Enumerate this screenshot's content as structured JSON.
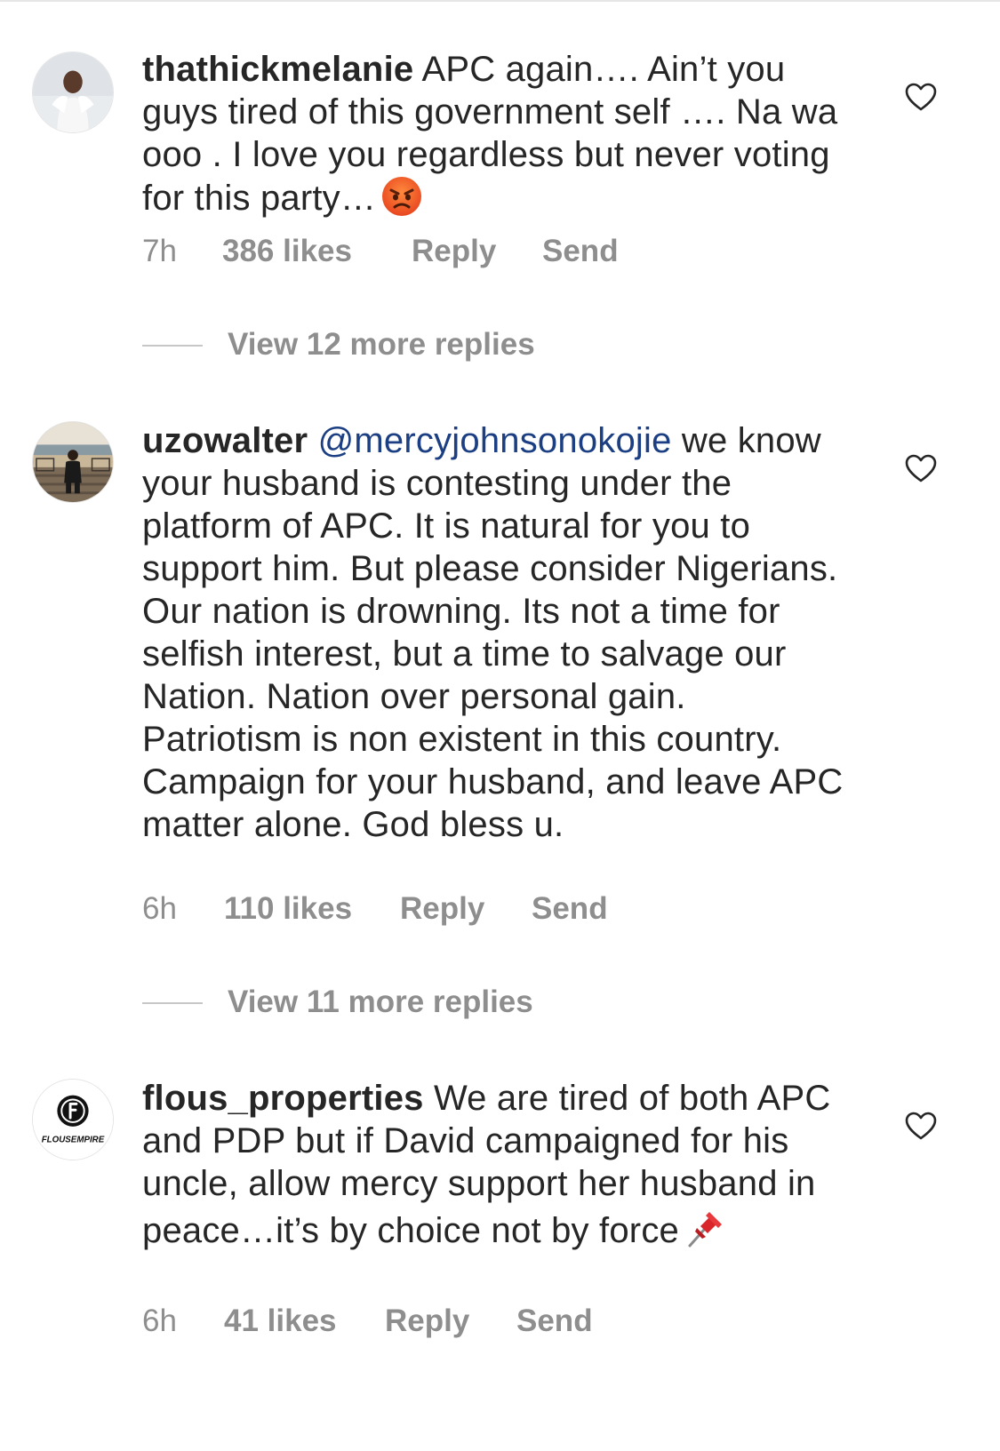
{
  "comments": [
    {
      "username": "thathickmelanie",
      "text": "APC again…. Ain’t you guys tired of this government self …. Na wa ooo . I love you regardless but never voting for this party…",
      "emoji": "angry-face-emoji",
      "time": "7h",
      "likes": "386 likes",
      "reply_label": "Reply",
      "send_label": "Send",
      "view_replies": "View 12 more replies"
    },
    {
      "username": "uzowalter",
      "mention": "@mercyjohnsonokojie",
      "text": "we know your husband is contesting under the platform of APC. It is natural for you to support him. But please consider Nigerians. Our nation is drowning. Its not a time for selfish interest, but a time to salvage our Nation. Nation over personal gain.  Patriotism is non existent in this country.  Campaign for your husband, and leave APC matter alone. God bless u.",
      "time": "6h",
      "likes": "110 likes",
      "reply_label": "Reply",
      "send_label": "Send",
      "view_replies": "View 11 more replies"
    },
    {
      "username": "flous_properties",
      "avatar_text": "FLOUSEMPIRE",
      "text": "We are tired of both APC and PDP but if David campaigned for his uncle, allow mercy support her husband in peace…it’s by choice not by force",
      "emoji": "pushpin-emoji",
      "time": "6h",
      "likes": "41 likes",
      "reply_label": "Reply",
      "send_label": "Send"
    }
  ],
  "icons": {
    "like": "heart-outline-icon"
  },
  "colors": {
    "text": "#262626",
    "meta": "#8e8e8e",
    "mention": "#1b3f82"
  }
}
